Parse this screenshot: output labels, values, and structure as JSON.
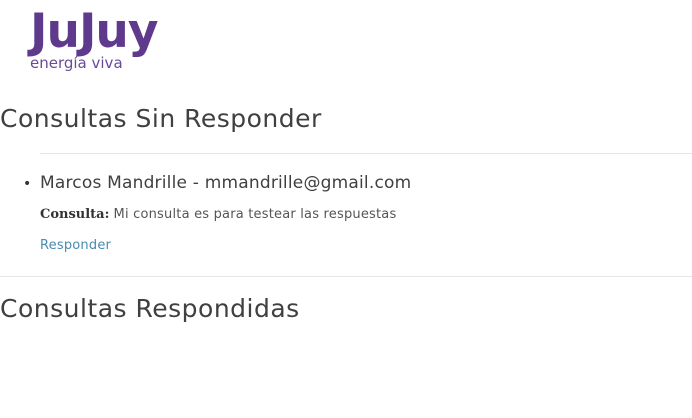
{
  "brand": {
    "name": "JuJuy",
    "tagline": "energía viva",
    "color": "#5f3a8c"
  },
  "pending": {
    "title": "Consultas Sin Responder",
    "items": [
      {
        "asker": "Marcos Mandrille - mmandrille@gmail.com",
        "query_label": "Consulta:",
        "query_text": "Mi consulta es para testear las respuestas",
        "reply_label": "Responder"
      }
    ]
  },
  "answered": {
    "title": "Consultas Respondidas"
  },
  "colors": {
    "link": "#4a8bb0",
    "divider": "#e6e6e6"
  }
}
